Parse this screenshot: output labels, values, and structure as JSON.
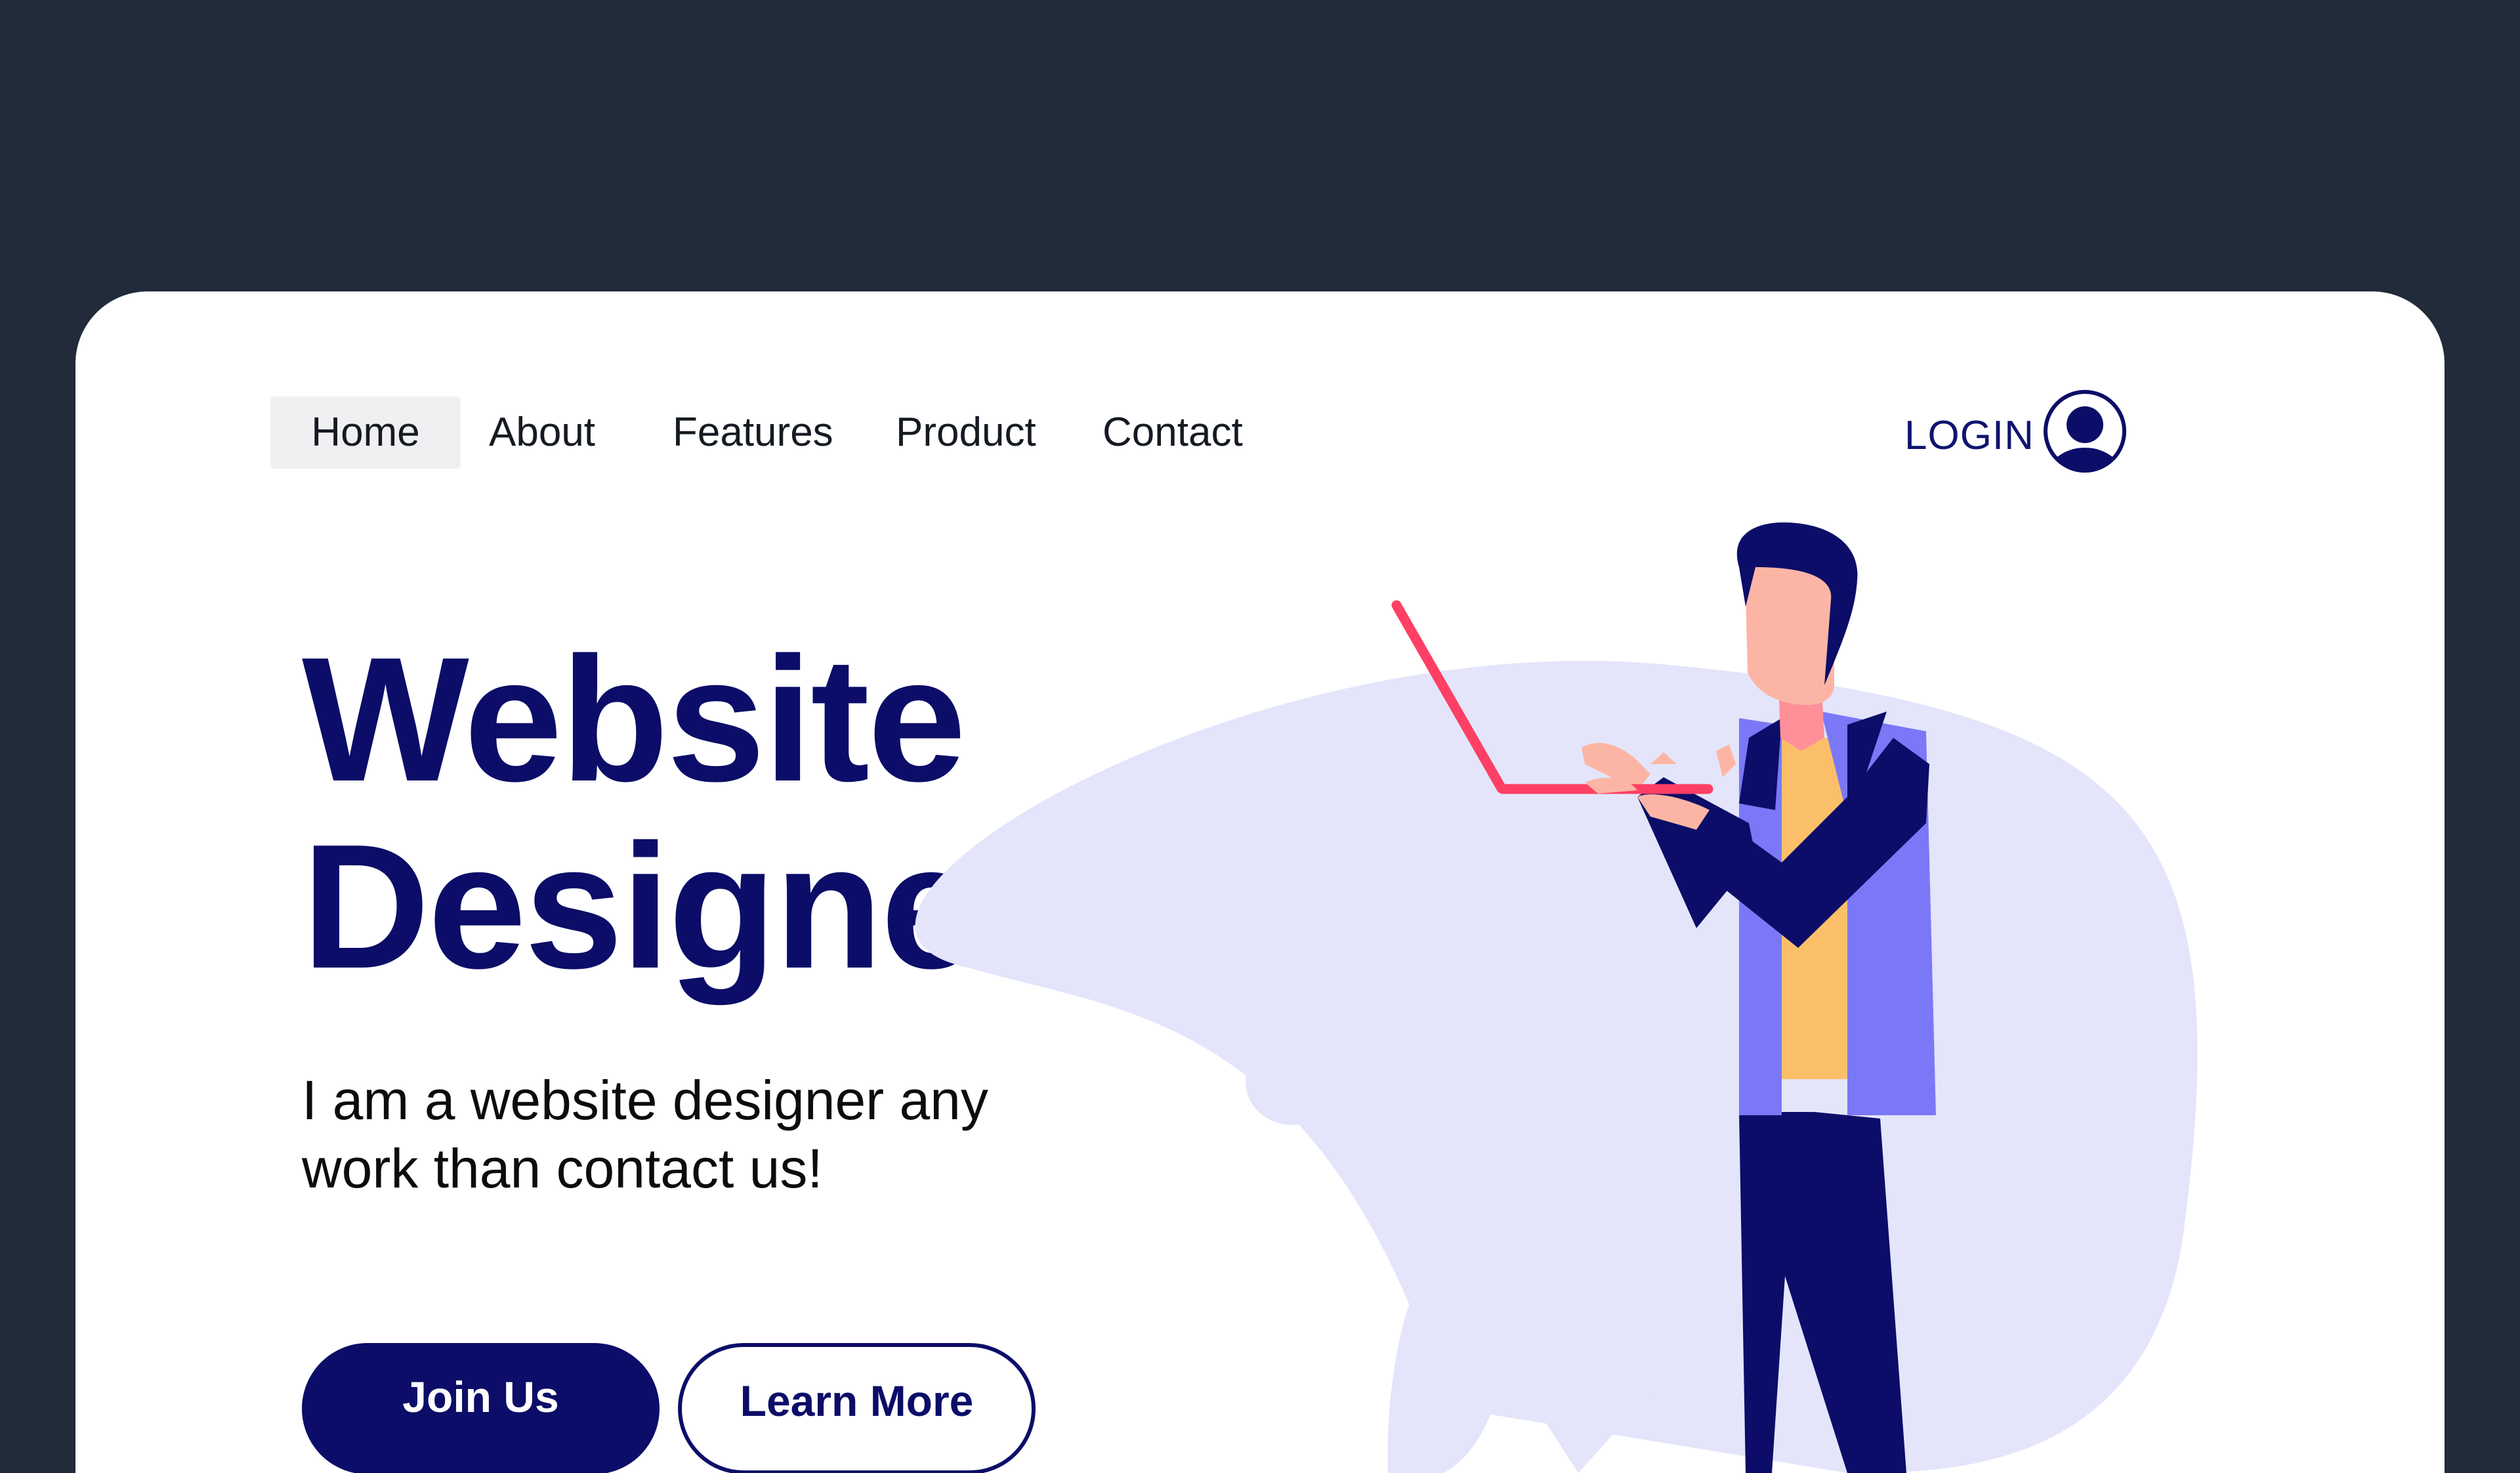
{
  "nav": {
    "items": [
      {
        "label": "Home",
        "active": true
      },
      {
        "label": "About"
      },
      {
        "label": "Features"
      },
      {
        "label": "Product"
      },
      {
        "label": "Contact"
      }
    ],
    "login_label": "LOGIN",
    "avatar_icon": "user-circle-icon"
  },
  "hero": {
    "title_line1": "Website",
    "title_line2": "Designer",
    "subtitle": "I am a website designer any work than contact us!",
    "primary_button": "Join Us",
    "secondary_button": "Learn More"
  },
  "colors": {
    "background": "#222b3a",
    "card": "#ffffff",
    "brand_navy": "#0b0d68",
    "blob": "#e4e5fb",
    "vest": "#7b78f7",
    "laptop": "#ff3f64",
    "skin": "#fcb5a4",
    "shirt": "#fbbf6a"
  }
}
